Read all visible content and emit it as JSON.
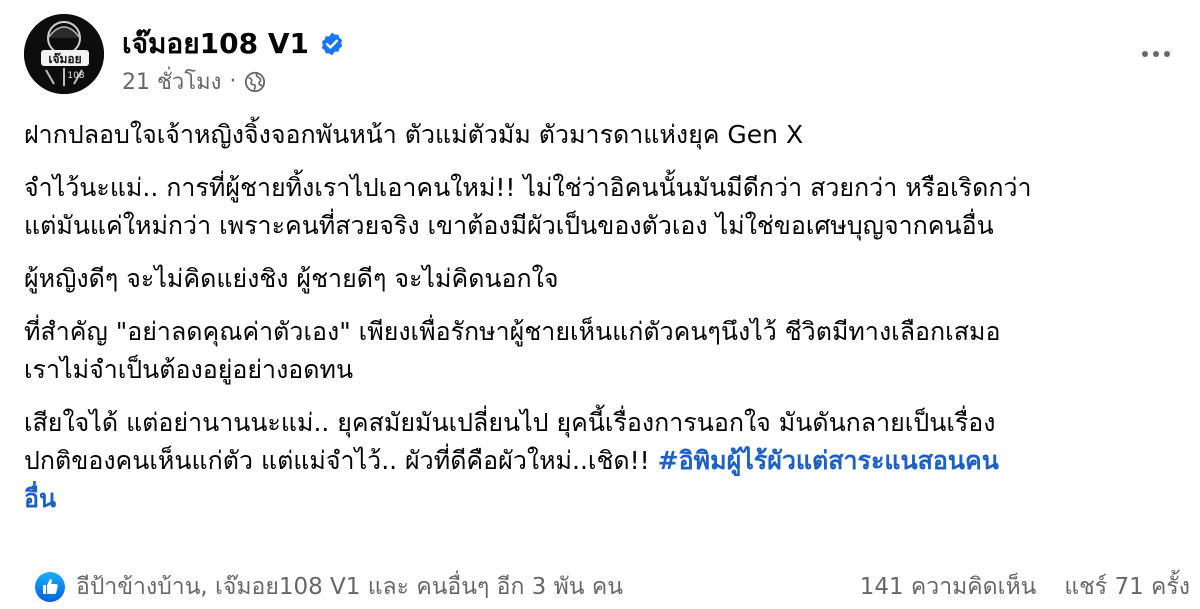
{
  "page": {
    "name": "เจ๊มอย108 V1",
    "avatar_text": "เจ๊มอย",
    "avatar_subtext": "108",
    "time": "21 ชั่วโมง",
    "separator": "·"
  },
  "post": {
    "paragraphs": [
      [
        "ฝากปลอบใจเจ้าหญิงจิ้งจอกพันหน้า ตัวแม่ตัวมัม ตัวมารดาแห่งยุค Gen X"
      ],
      [
        "จำไว้นะแม่.. การที่ผู้ชายทิ้งเราไปเอาคนใหม่!! ไม่ใช่ว่าอิคนนั้นมันมีดีกว่า สวยกว่า หรือเริดกว่า",
        "แต่มันแค่ใหม่กว่า เพราะคนที่สวยจริง เขาต้องมีผัวเป็นของตัวเอง ไม่ใช่ขอเศษบุญจากคนอื่น"
      ],
      [
        "ผู้หญิงดีๆ จะไม่คิดแย่งชิง ผู้ชายดีๆ จะไม่คิดนอกใจ"
      ],
      [
        "ที่สำคัญ \"อย่าลดคุณค่าตัวเอง\" เพียงเพื่อรักษาผู้ชายเห็นแก่ตัวคนๆนึงไว้ ชีวิตมีทางเลือกเสมอ",
        "เราไม่จำเป็นต้องอยู่อย่างอดทน"
      ]
    ],
    "last_paragraph": {
      "line1": "เสียใจได้ แต่อย่านานนะแม่.. ยุคสมัยมันเปลี่ยนไป ยุคนี้เรื่องการนอกใจ มันดันกลายเป็นเรื่อง",
      "line2": "ปกติของคนเห็นแก่ตัว แต่แม่จำไว้.. ผัวที่ดีคือผัวใหม่..เชิด!! ",
      "hashtag_part1": "#อิพิมผู้ไร้ผัวแต่สาระแนสอนคน",
      "hashtag_part2": "อื่น"
    }
  },
  "footer": {
    "reactions_text": "อีป้าข้างบ้าน, เจ๊มอย108 V1 และ คนอื่นๆ อีก 3 พัน คน",
    "comments": "141 ความคิดเห็น",
    "shares": "แชร์ 71 ครั้ง"
  },
  "colors": {
    "accent": "#1877f2",
    "hashtag": "#1b5fc7",
    "secondary_text": "#65676b"
  },
  "icons": {
    "verified": "verified-badge-icon",
    "privacy": "globe-icon",
    "more": "more-dots-icon",
    "reaction": "like-icon"
  }
}
